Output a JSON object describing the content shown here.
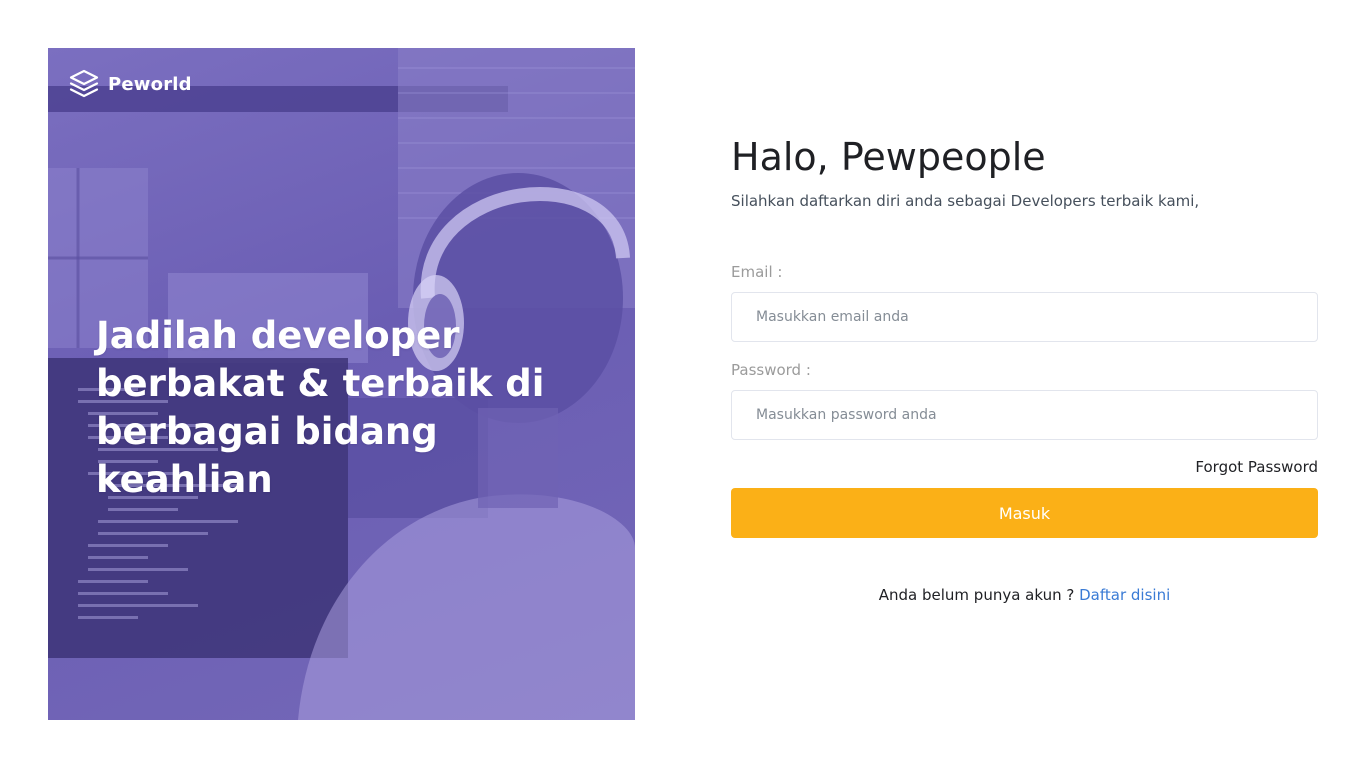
{
  "brand": {
    "name": "Peworld",
    "logo_icon": "layers-icon"
  },
  "hero": {
    "headline": "Jadilah developer berbakat & terbaik di berbagai bidang keahlian",
    "background_image": "developer-with-headphones-photo"
  },
  "form": {
    "title": "Halo, Pewpeople",
    "subtitle": "Silahkan daftarkan diri anda sebagai Developers terbaik kami,",
    "email": {
      "label": "Email :",
      "placeholder": "Masukkan email anda",
      "value": ""
    },
    "password": {
      "label": "Password :",
      "placeholder": "Masukkan password anda",
      "value": ""
    },
    "forgot_label": "Forgot Password",
    "submit_label": "Masuk",
    "register_prompt": "Anda belum punya akun ?",
    "register_link": "Daftar disini"
  },
  "colors": {
    "hero_overlay": "#6a5db3",
    "primary_button": "#fbb017",
    "link": "#3a7bd5",
    "title_text": "#1f2024"
  }
}
